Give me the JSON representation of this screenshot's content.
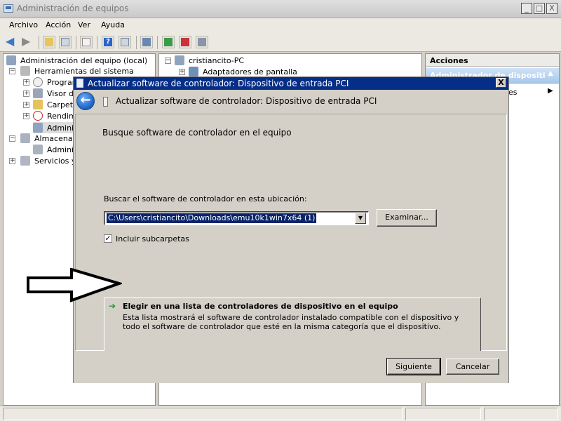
{
  "window": {
    "title": "Administración de equipos"
  },
  "caption_buttons": {
    "min": "_",
    "max": "□",
    "close": "X"
  },
  "menu": [
    "Archivo",
    "Acción",
    "Ver",
    "Ayuda"
  ],
  "left_tree": [
    {
      "label": "Administración del equipo (local)"
    },
    {
      "label": "Herramientas del sistema",
      "exp": "−"
    },
    {
      "label": "Program",
      "exp": "+"
    },
    {
      "label": "Visor de",
      "exp": "+"
    },
    {
      "label": "Carpeta",
      "exp": "+"
    },
    {
      "label": "Rendim",
      "exp": "+"
    },
    {
      "label": "Adminis"
    },
    {
      "label": "Almacenam",
      "exp": "−"
    },
    {
      "label": "Adminis"
    },
    {
      "label": "Servicios y",
      "exp": "+"
    }
  ],
  "mid_tree": [
    {
      "label": "cristiancito-PC",
      "exp": "−"
    },
    {
      "label": "Adaptadores de pantalla",
      "exp": "+"
    }
  ],
  "actions": {
    "heading": "Acciones",
    "subheading": "Administrador de dispositi",
    "more": "es"
  },
  "dialog": {
    "title": "Actualizar software de controlador: Dispositivo de entrada PCI",
    "close": "X",
    "header": "Actualizar software de controlador: Dispositivo de entrada PCI",
    "section_title": "Busque software de controlador en el equipo",
    "search_label": "Buscar el software de controlador en esta ubicación:",
    "path_value": "C:\\Users\\cristiancito\\Downloads\\emu10k1win7x64 (1)",
    "browse_button": "Examinar...",
    "include_subfolders": "Incluir subcarpetas",
    "choose_title": "Elegir en una lista de controladores de dispositivo en el equipo",
    "choose_desc": "Esta lista mostrará el software de controlador instalado compatible con el dispositivo y todo el software de controlador que esté en la misma categoría que el dispositivo.",
    "next_button": "Siguiente",
    "cancel_button": "Cancelar"
  }
}
